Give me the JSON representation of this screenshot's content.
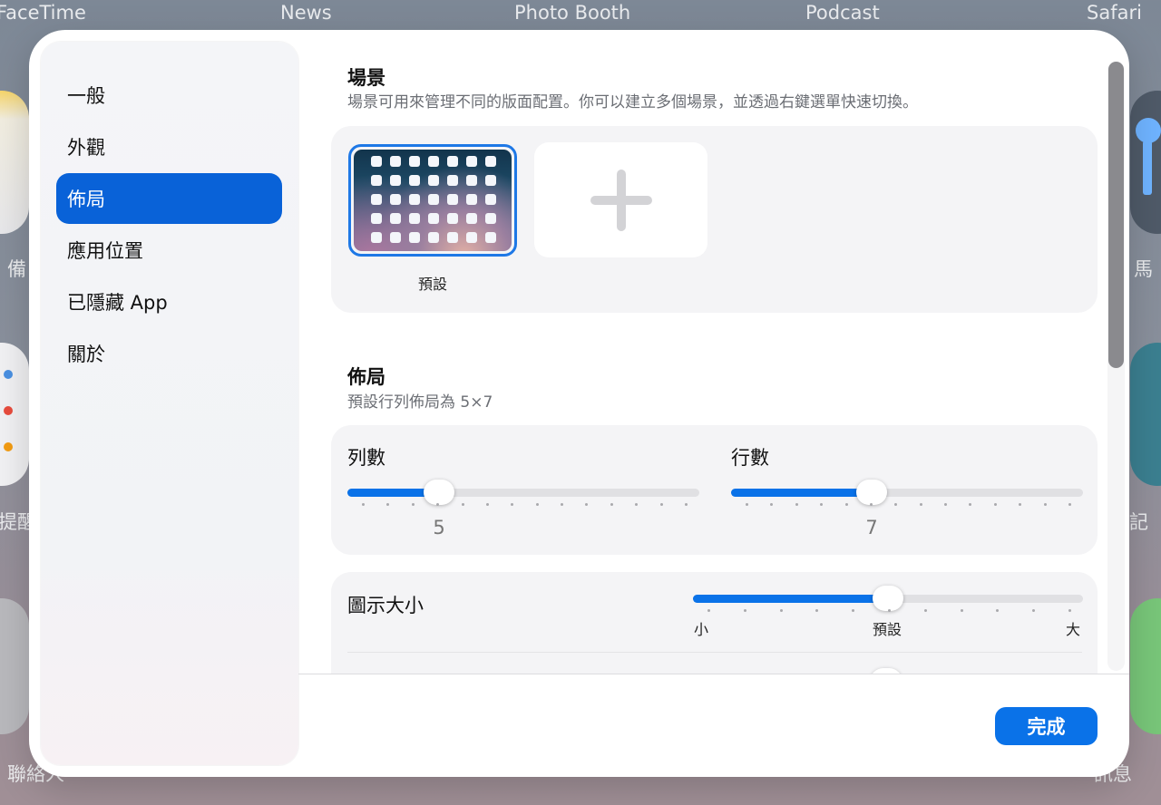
{
  "background": {
    "top_labels": [
      "FaceTime",
      "News",
      "Photo Booth",
      "Podcast",
      "Safari"
    ],
    "side_labels": [
      "備",
      "提醒",
      "聯絡人",
      "馬",
      "記",
      "訊息"
    ]
  },
  "sidebar": {
    "items": [
      {
        "label": "一般",
        "active": false
      },
      {
        "label": "外觀",
        "active": false
      },
      {
        "label": "佈局",
        "active": true
      },
      {
        "label": "應用位置",
        "active": false
      },
      {
        "label": "已隱藏 App",
        "active": false
      },
      {
        "label": "關於",
        "active": false
      }
    ]
  },
  "scenes": {
    "title": "場景",
    "subtitle": "場景可用來管理不同的版面配置。你可以建立多個場景，並透過右鍵選單快速切換。",
    "items": [
      {
        "label": "預設",
        "selected": true
      }
    ],
    "add_icon": "plus-icon"
  },
  "layout": {
    "title": "佈局",
    "subtitle": "預設行列佈局為 5×7",
    "columns": {
      "label": "列數",
      "value": "5",
      "fraction": 0.26
    },
    "rows": {
      "label": "行數",
      "value": "7",
      "fraction": 0.4
    }
  },
  "icon_size": {
    "label": "圖示大小",
    "fraction": 0.5,
    "min_label": "小",
    "mid_label": "預設",
    "max_label": "大"
  },
  "footer": {
    "done_label": "完成"
  },
  "colors": {
    "accent": "#0a72e8",
    "sidebar_active": "#0962d8"
  }
}
